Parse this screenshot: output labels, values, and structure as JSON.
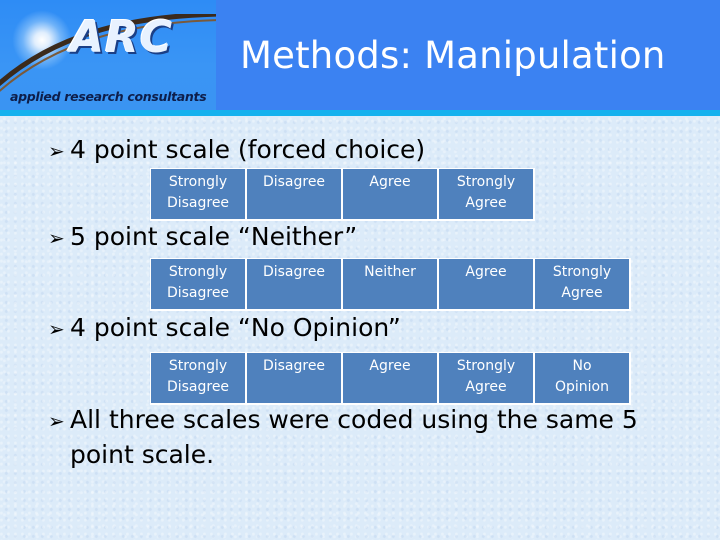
{
  "logo": {
    "brand": "ARC",
    "tagline": "applied research consultants"
  },
  "slide": {
    "title": "Methods: Manipulation"
  },
  "colors": {
    "header": "#3b82f2",
    "header_strip": "#14b1ee",
    "cell": "#4f81bd",
    "cell_text": "#ffffff",
    "background": "#dcebf9"
  },
  "bullets": [
    {
      "icon": "arrow-bullet-icon",
      "text": "4 point scale (forced choice)"
    },
    {
      "icon": "arrow-bullet-icon",
      "text": "5 point scale “Neither”"
    },
    {
      "icon": "arrow-bullet-icon",
      "text": "4 point scale “No Opinion”"
    },
    {
      "icon": "arrow-bullet-icon",
      "text": "All three scales were coded using the same 5",
      "continuation": "point scale."
    }
  ],
  "scales": [
    {
      "name": "forced-choice",
      "options": [
        [
          "Strongly",
          "Disagree"
        ],
        [
          "Disagree",
          ""
        ],
        [
          "Agree",
          ""
        ],
        [
          "Strongly",
          "Agree"
        ]
      ]
    },
    {
      "name": "neither",
      "options": [
        [
          "Strongly",
          "Disagree"
        ],
        [
          "Disagree",
          ""
        ],
        [
          "Neither",
          ""
        ],
        [
          "Agree",
          ""
        ],
        [
          "Strongly",
          "Agree"
        ]
      ]
    },
    {
      "name": "no-opinion",
      "options": [
        [
          "Strongly",
          "Disagree"
        ],
        [
          "Disagree",
          ""
        ],
        [
          "Agree",
          ""
        ],
        [
          "Strongly",
          "Agree"
        ],
        [
          "No",
          "Opinion"
        ]
      ]
    }
  ]
}
